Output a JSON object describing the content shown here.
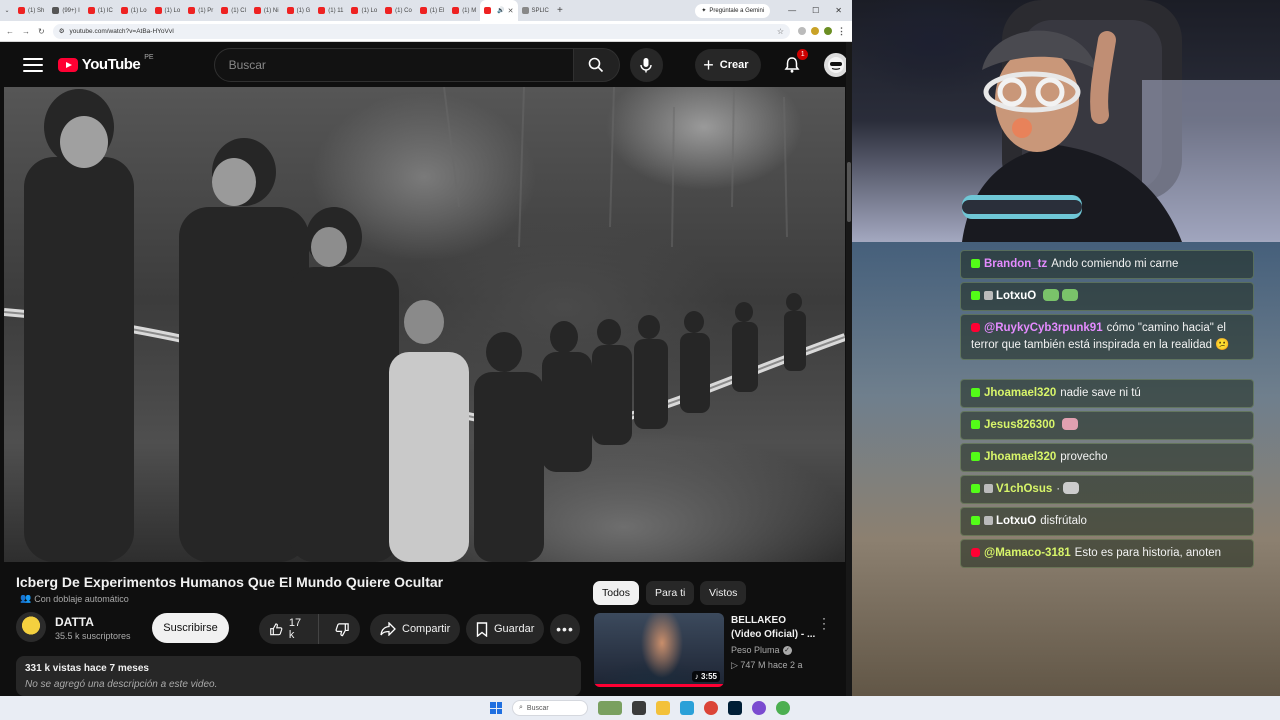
{
  "browser": {
    "tabs": [
      {
        "label": "(1) Sh",
        "active": false
      },
      {
        "label": "(99+) I",
        "active": false
      },
      {
        "label": "(1) IC",
        "active": false
      },
      {
        "label": "(1) Lo",
        "active": false
      },
      {
        "label": "(1) Lo",
        "active": false
      },
      {
        "label": "(1) Pr",
        "active": false
      },
      {
        "label": "(1) Cl",
        "active": false
      },
      {
        "label": "(1) Ni",
        "active": false
      },
      {
        "label": "(1) G",
        "active": false
      },
      {
        "label": "(1) 11",
        "active": false
      },
      {
        "label": "(1) Lo",
        "active": false
      },
      {
        "label": "(1) Co",
        "active": false
      },
      {
        "label": "(1) El",
        "active": false
      },
      {
        "label": "(1) M",
        "active": false
      },
      {
        "label": "",
        "active": true
      },
      {
        "label": "SPLIC",
        "active": false
      }
    ],
    "gemini_label": "Pregúntale a Gemini",
    "url": "youtube.com/watch?v=AtBa-HYoVvI"
  },
  "youtube": {
    "logo_text": "YouTube",
    "country_code": "PE",
    "search_placeholder": "Buscar",
    "create_label": "Crear",
    "notification_count": "1",
    "video": {
      "title": "Icberg De Experimentos Humanos Que El Mundo Quiere Ocultar",
      "dubbing": "Con doblaje automático",
      "channel": "DATTA",
      "subscribers": "35.5 k suscriptores",
      "subscribe_label": "Suscribirse",
      "likes": "17 k",
      "share_label": "Compartir",
      "save_label": "Guardar",
      "stats": "331 k vistas  hace 7 meses",
      "description": "No se agregó una descripción a este video."
    },
    "chips": [
      "Todos",
      "Para ti",
      "Vistos"
    ],
    "recommendation": {
      "title": "BELLAKEO (Video Oficial) - ...",
      "channel": "Peso Pluma",
      "meta": "747 M  hace 2 a",
      "duration": "3:55"
    }
  },
  "chat": [
    {
      "platform": "kick",
      "user": "Brandon_tz",
      "user_color": "#e58bff",
      "text": "Ando comiendo mi carne",
      "badge": false
    },
    {
      "platform": "kick",
      "user": "LotxuO",
      "user_color": "#ffffff",
      "text": "",
      "badge": true,
      "emotes": [
        "#7ac36a",
        "#7ac36a"
      ]
    },
    {
      "platform": "yt",
      "user": "@RuykyCyb3rpunk91",
      "user_color": "#e58bff",
      "text": "cómo \"camino hacia\" el terror que también está inspirada en la realidad 😕",
      "badge": false
    },
    {
      "platform": "kick",
      "user": "Jhoamael320",
      "user_color": "#d8f56a",
      "text": "nadie save ni tú",
      "badge": false
    },
    {
      "platform": "kick",
      "user": "Jesus826300",
      "user_color": "#d8f56a",
      "text": "",
      "badge": false,
      "emotes": [
        "#e0a0b0"
      ]
    },
    {
      "platform": "kick",
      "user": "Jhoamael320",
      "user_color": "#d8f56a",
      "text": "provecho",
      "badge": false
    },
    {
      "platform": "kick",
      "user": "V1chOsus",
      "user_color": "#d8f56a",
      "text": "·",
      "badge": true,
      "emotes": [
        "#cccccc"
      ]
    },
    {
      "platform": "kick",
      "user": "LotxuO",
      "user_color": "#ffffff",
      "text": "disfrútalo",
      "badge": true
    },
    {
      "platform": "yt",
      "user": "@Mamaco-3181",
      "user_color": "#d8f56a",
      "text": "Esto es para historia, anoten",
      "badge": false
    }
  ],
  "taskbar": {
    "search_label": "Buscar"
  }
}
